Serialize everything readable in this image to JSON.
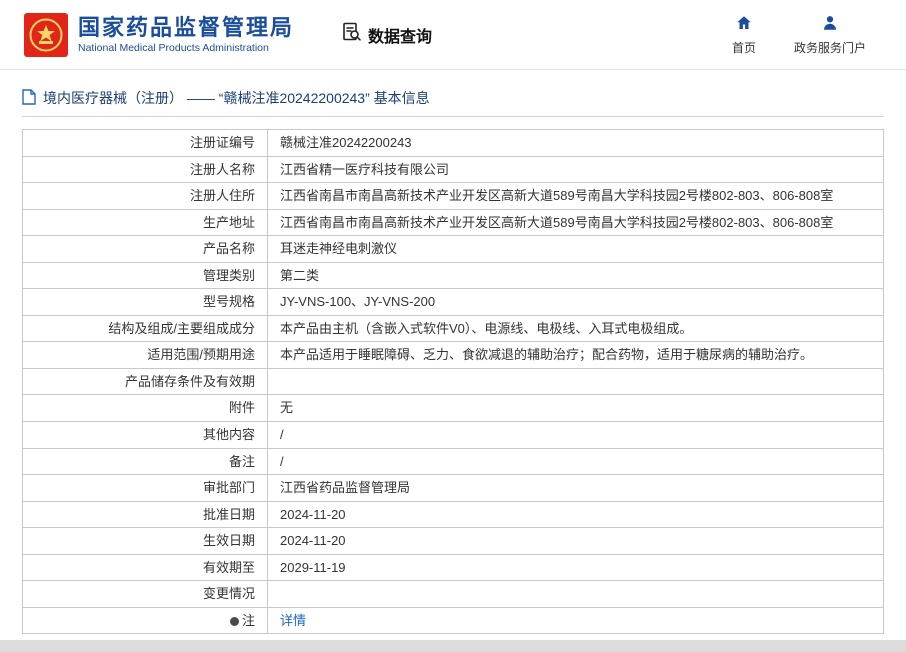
{
  "header": {
    "title": "国家药品监督管理局",
    "subtitle": "National Medical Products Administration",
    "data_query_label": "数据查询",
    "nav": [
      {
        "label": "首页",
        "icon": "home-icon"
      },
      {
        "label": "政务服务门户",
        "icon": "user-icon"
      }
    ]
  },
  "breadcrumb": {
    "text": "境内医疗器械（注册） ——  “赣械注准20242200243” 基本信息"
  },
  "table": {
    "rows": [
      {
        "label": "注册证编号",
        "value": "赣械注准20242200243"
      },
      {
        "label": "注册人名称",
        "value": "江西省精一医疗科技有限公司"
      },
      {
        "label": "注册人住所",
        "value": "江西省南昌市南昌高新技术产业开发区高新大道589号南昌大学科技园2号楼802-803、806-808室"
      },
      {
        "label": "生产地址",
        "value": "江西省南昌市南昌高新技术产业开发区高新大道589号南昌大学科技园2号楼802-803、806-808室"
      },
      {
        "label": "产品名称",
        "value": "耳迷走神经电刺激仪"
      },
      {
        "label": "管理类别",
        "value": "第二类"
      },
      {
        "label": "型号规格",
        "value": "JY-VNS-100、JY-VNS-200"
      },
      {
        "label": "结构及组成/主要组成成分",
        "value": "本产品由主机（含嵌入式软件V0）、电源线、电极线、入耳式电极组成。"
      },
      {
        "label": "适用范围/预期用途",
        "value": "本产品适用于睡眠障碍、乏力、食欲减退的辅助治疗；配合药物，适用于糖尿病的辅助治疗。"
      },
      {
        "label": "产品储存条件及有效期",
        "value": ""
      },
      {
        "label": "附件",
        "value": "无"
      },
      {
        "label": "其他内容",
        "value": "/"
      },
      {
        "label": "备注",
        "value": "/"
      },
      {
        "label": "审批部门",
        "value": "江西省药品监督管理局"
      },
      {
        "label": "批准日期",
        "value": "2024-11-20"
      },
      {
        "label": "生效日期",
        "value": "2024-11-20"
      },
      {
        "label": "有效期至",
        "value": "2029-11-19"
      },
      {
        "label": "变更情况",
        "value": ""
      },
      {
        "label": "注",
        "value": "详情"
      }
    ]
  },
  "icons": {
    "nmpa-logo": "national-emblem",
    "data-query-icon": "document-with-magnifier",
    "home-icon": "house",
    "user-icon": "person",
    "document-icon": "page",
    "note-icon": "filled-circle"
  },
  "colors": {
    "accent_blue": "#1a4e9c",
    "emblem_red": "#e12619",
    "emblem_gold": "#ffd766",
    "link_blue": "#1a66c8",
    "table_border": "#c8c8c8",
    "heading_text": "#1b3f75"
  }
}
